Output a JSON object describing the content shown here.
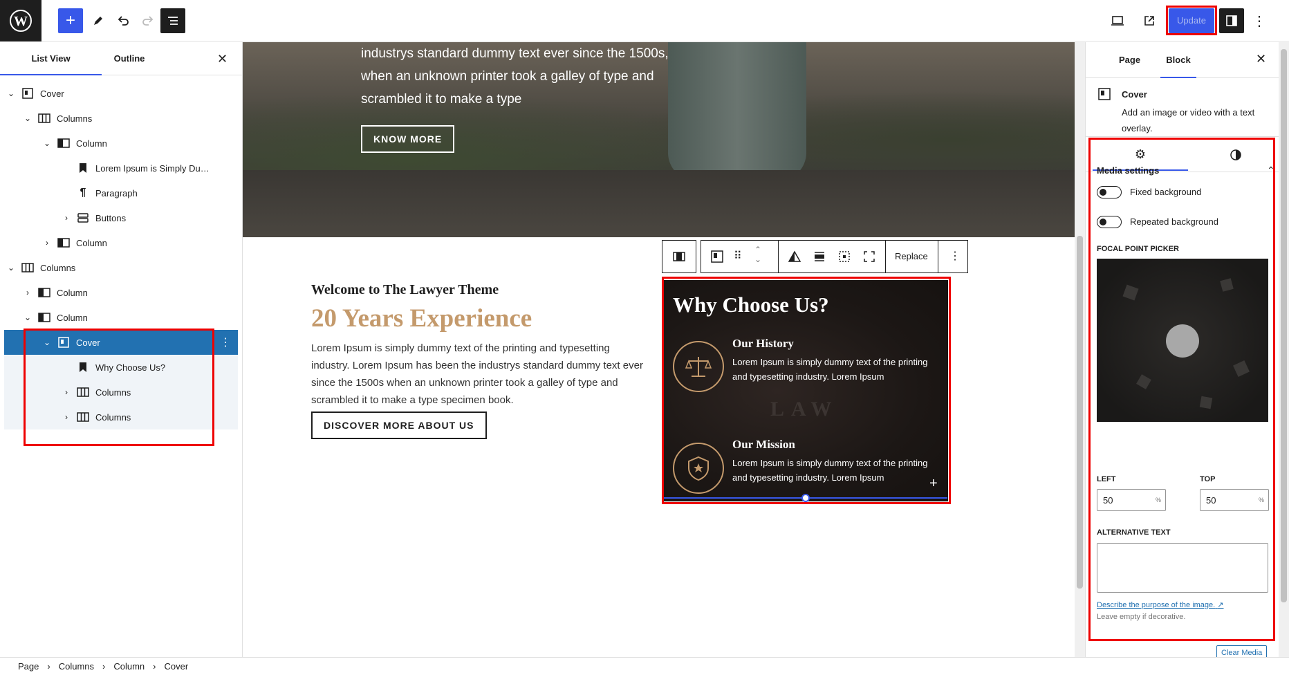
{
  "topbar": {
    "update_label": "Update",
    "icons": [
      "wordpress-logo",
      "plus-icon",
      "pencil-icon",
      "undo-icon",
      "redo-icon",
      "list-view-icon",
      "desktop-preview-icon",
      "external-link-icon",
      "sidebar-toggle-icon",
      "more-vertical-icon"
    ]
  },
  "left_panel": {
    "tabs": [
      "List View",
      "Outline"
    ],
    "tree": [
      {
        "label": "Cover",
        "icon": "cover-icon"
      },
      {
        "label": "Columns",
        "icon": "columns-icon"
      },
      {
        "label": "Column",
        "icon": "column-icon"
      },
      {
        "label": "Lorem Ipsum is Simply Du…",
        "icon": "bookmark-icon"
      },
      {
        "label": "Paragraph",
        "icon": "paragraph-icon"
      },
      {
        "label": "Buttons",
        "icon": "buttons-icon"
      },
      {
        "label": "Column",
        "icon": "column-icon"
      },
      {
        "label": "Columns",
        "icon": "columns-icon"
      },
      {
        "label": "Column",
        "icon": "column-icon"
      },
      {
        "label": "Column",
        "icon": "column-icon"
      },
      {
        "label": "Cover",
        "icon": "cover-icon"
      },
      {
        "label": "Why Choose Us?",
        "icon": "bookmark-icon"
      },
      {
        "label": "Columns",
        "icon": "columns-icon"
      },
      {
        "label": "Columns",
        "icon": "columns-icon"
      }
    ]
  },
  "canvas": {
    "hero": {
      "line1": "industrys standard dummy text ever since the 1500s,",
      "line2": "when an unknown printer took a galley of type and",
      "line3": "scrambled it to make a type",
      "button": "KNOW MORE"
    },
    "welcome": {
      "kicker": "Welcome to The Lawyer Theme",
      "title": "20 Years Experience",
      "body": "Lorem Ipsum is simply dummy text of the printing and typesetting industry. Lorem Ipsum has been the industrys standard dummy text ever since the 1500s when an unknown printer took a galley of type and scrambled it to make a type specimen book.",
      "button": "DISCOVER MORE ABOUT US"
    },
    "toolbar": {
      "replace_label": "Replace"
    },
    "why": {
      "title": "Why Choose Us?",
      "history_title": "Our History",
      "history_body": "Lorem Ipsum is simply dummy text of the printing and typesetting industry. Lorem Ipsum",
      "mission_title": "Our Mission",
      "mission_body": "Lorem Ipsum is simply dummy text of the printing and typesetting industry. Lorem Ipsum",
      "law_tiles": "LAW"
    }
  },
  "right_panel": {
    "tabs": [
      "Page",
      "Block"
    ],
    "block_name": "Cover",
    "block_desc": "Add an image or video with a text overlay.",
    "section": "Media settings",
    "fixed_bg": "Fixed background",
    "repeated_bg": "Repeated background",
    "focal_label": "FOCAL POINT PICKER",
    "left_label": "LEFT",
    "top_label": "TOP",
    "left_value": "50",
    "top_value": "50",
    "unit": "%",
    "alt_label": "ALTERNATIVE TEXT",
    "alt_link": "Describe the purpose of the image.",
    "alt_help": "Leave empty if decorative.",
    "clear_media": "Clear Media"
  },
  "breadcrumb": [
    "Page",
    "Columns",
    "Column",
    "Cover"
  ],
  "colors": {
    "accent": "#3858e9",
    "selected": "#2271b1",
    "gold": "#c49a6c",
    "highlight": "#e00000"
  }
}
